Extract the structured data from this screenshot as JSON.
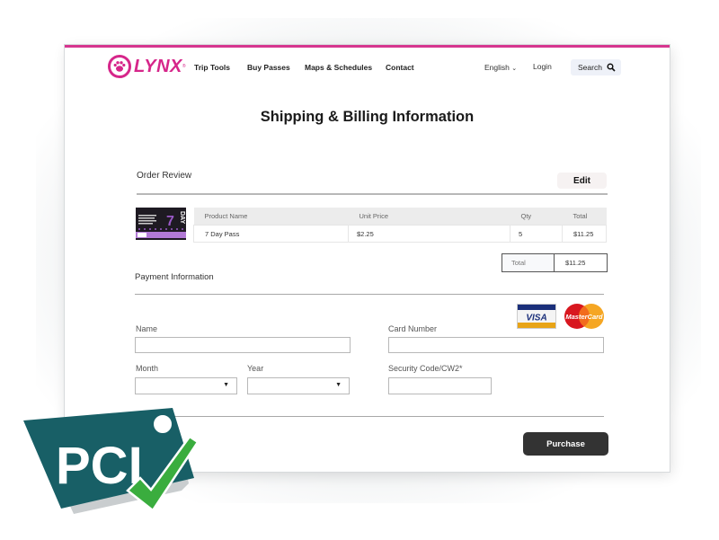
{
  "nav": {
    "brand": "LYNX",
    "links": [
      "Trip Tools",
      "Buy Passes",
      "Maps & Schedules",
      "Contact"
    ],
    "language": "English",
    "login": "Login",
    "search": "Search"
  },
  "page_title": "Shipping & Billing Information",
  "order_review": {
    "heading": "Order Review",
    "edit_label": "Edit",
    "ticket_image": "7 Day Pass ticket",
    "columns": [
      "Product Name",
      "Unit Price",
      "Qty",
      "Total"
    ],
    "rows": [
      {
        "product": "7 Day Pass",
        "unit_price": "$2.25",
        "qty": "5",
        "total": "$11.25"
      }
    ],
    "total_label": "Total",
    "total_value": "$11.25"
  },
  "payment": {
    "heading": "Payment Information",
    "name_label": "Name",
    "name_value": "",
    "card_number_label": "Card Number",
    "card_number_value": "",
    "month_label": "Month",
    "month_value": "",
    "year_label": "Year",
    "year_value": "",
    "security_label": "Security Code/CW2*",
    "security_value": "",
    "card_logos": [
      "VISA",
      "MasterCard"
    ],
    "purchase_label": "Purchase"
  },
  "badge": {
    "text": "PCI",
    "colors": {
      "panel": "#185f66",
      "check": "#3aad3e",
      "brand": "#d6268a"
    }
  }
}
